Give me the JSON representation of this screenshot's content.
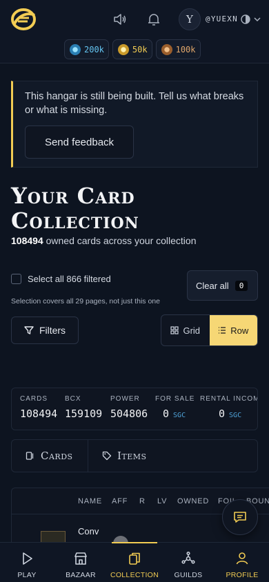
{
  "header": {
    "avatar_initial": "Y",
    "username": "@YUEXN",
    "balances": [
      {
        "icon": "blue-gem-coin-icon",
        "value": "200k",
        "color": "#64c4f0"
      },
      {
        "icon": "gold-coin-icon",
        "value": "50k",
        "color": "#f2cc53"
      },
      {
        "icon": "bronze-coin-icon",
        "value": "100k",
        "color": "#e0a66a"
      }
    ]
  },
  "notice": {
    "text": "This hangar is still being built. Tell us what breaks or what is missing.",
    "button_label": "Send feedback"
  },
  "page": {
    "title": "Your Card Collection",
    "owned_count": "108494",
    "owned_suffix": " owned cards across your collection"
  },
  "selection": {
    "select_all_label": "Select all 866 filtered",
    "note": "Selection covers all 29 pages, not just this one",
    "clear_label": "Clear all",
    "clear_count": "0"
  },
  "toolbar": {
    "filters_label": "Filters",
    "view_options": [
      "Grid",
      "Row"
    ],
    "active_view": "Row"
  },
  "stats": [
    {
      "label": "CARDS",
      "value": "108494"
    },
    {
      "label": "BCX",
      "value": "159109"
    },
    {
      "label": "POWER",
      "value": "504806"
    },
    {
      "label": "FOR SALE",
      "value": "0",
      "unit": "SGC"
    },
    {
      "label": "RENTAL INCOME",
      "value": "0",
      "unit": "SGC"
    }
  ],
  "tabs": [
    "Cards",
    "Items"
  ],
  "table": {
    "columns": [
      "NAME",
      "AFF",
      "R",
      "LV",
      "OWNED",
      "FOIL",
      "BOUN"
    ],
    "first_row_name": "Conv"
  },
  "bottom_nav": [
    "PLAY",
    "BAZAAR",
    "COLLECTION",
    "GUILDS",
    "PROFILE"
  ],
  "active_nav": "COLLECTION",
  "colors": {
    "accent": "#f2cc53",
    "background": "#0d1420",
    "sgc": "#4fa3d9"
  }
}
